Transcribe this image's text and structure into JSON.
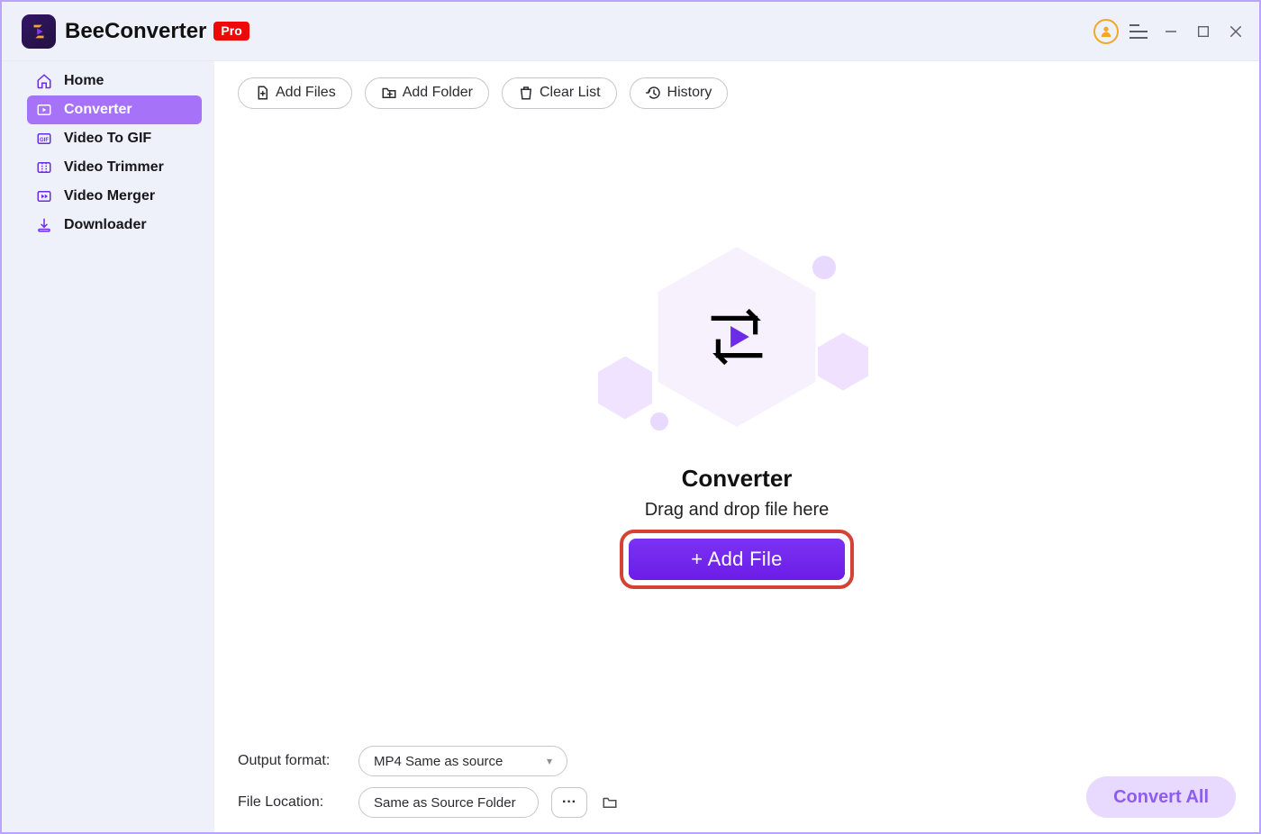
{
  "title_bar": {
    "app_name": "BeeConverter",
    "pro_badge": "Pro"
  },
  "sidebar": {
    "items": [
      {
        "label": "Home"
      },
      {
        "label": "Converter"
      },
      {
        "label": "Video To GIF"
      },
      {
        "label": "Video Trimmer"
      },
      {
        "label": "Video Merger"
      },
      {
        "label": "Downloader"
      }
    ]
  },
  "toolbar": {
    "add_files_label": "Add Files",
    "add_folder_label": "Add Folder",
    "clear_list_label": "Clear List",
    "history_label": "History"
  },
  "drop_zone": {
    "title": "Converter",
    "subtitle": "Drag and drop file here",
    "add_file_label": "+ Add File"
  },
  "footer": {
    "output_format_label": "Output format:",
    "output_format_value": "MP4 Same as source",
    "file_location_label": "File Location:",
    "file_location_value": "Same as Source Folder",
    "convert_all_label": "Convert All"
  }
}
